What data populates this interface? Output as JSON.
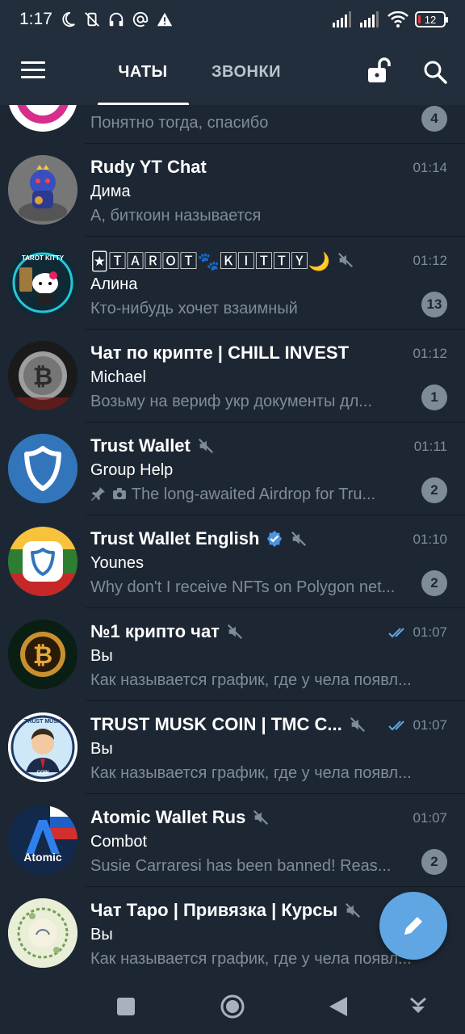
{
  "status_bar": {
    "time": "1:17",
    "battery_level": "12",
    "icons": [
      "moon-icon",
      "vibrate-off-icon",
      "headphones-icon",
      "at-icon",
      "warning-icon",
      "signal-icon",
      "signal-icon",
      "wifi-icon",
      "battery-icon"
    ]
  },
  "header": {
    "tabs": [
      {
        "label": "ЧАТЫ",
        "active": true
      },
      {
        "label": "ЗВОНКИ",
        "active": false
      }
    ],
    "icons": [
      "menu-icon",
      "lock-open-icon",
      "search-icon"
    ]
  },
  "colors": {
    "background": "#1d2733",
    "header": "#232e3c",
    "secondary_text": "#7f8c99",
    "badge": "#7e8b98",
    "accent": "#5fa6e3",
    "verified": "#4a95e0",
    "read_ticks": "#5fa6e3"
  },
  "chats": [
    {
      "title": "",
      "sender": "",
      "preview": "Понятно тогда, спасибо",
      "time": "",
      "badge": "4",
      "muted": false
    },
    {
      "title": "Rudy YT Chat",
      "sender": "Дима",
      "preview": "А, биткоин называется",
      "time": "01:14",
      "badge": "",
      "muted": false
    },
    {
      "title": "🃏🅃🄰🅁🄾🅃🐾🄺🄸🅃🅃🅈🌙",
      "sender": "Алина",
      "preview": "Кто-нибудь хочет взаимный",
      "time": "01:12",
      "badge": "13",
      "muted": true
    },
    {
      "title": "Чат по крипте | CHILL INVEST",
      "sender": "Michael",
      "preview": "Возьму на вериф укр документы дл...",
      "time": "01:12",
      "badge": "1",
      "muted": false
    },
    {
      "title": "Trust Wallet",
      "sender": "Group Help",
      "preview": "The long-awaited Airdrop for Tru...",
      "time": "01:11",
      "badge": "2",
      "muted": true,
      "pinned_photo": true
    },
    {
      "title": "Trust Wallet English",
      "sender": "Younes",
      "preview": "Why don't I receive NFTs on Polygon net...",
      "time": "01:10",
      "badge": "2",
      "muted": true,
      "verified": true
    },
    {
      "title": "№1 крипто чат",
      "sender": "Вы",
      "preview": "Как называется график, где у чела появл...",
      "time": "01:07",
      "badge": "",
      "muted": true,
      "read": true
    },
    {
      "title": "TRUST MUSK COIN | TMC C...",
      "sender": "Вы",
      "preview": "Как называется график, где у чела появл...",
      "time": "01:07",
      "badge": "",
      "muted": true,
      "read": true
    },
    {
      "title": "Atomic Wallet Rus",
      "sender": "Combot",
      "preview": "Susie Carraresi has been banned! Reas...",
      "time": "01:07",
      "badge": "2",
      "muted": true
    },
    {
      "title": "Чат Таро | Привязка | Курсы",
      "sender": "Вы",
      "preview": "Как называется график, где у чела появл...",
      "time": "",
      "badge": "",
      "muted": true
    }
  ],
  "avatar_text": {
    "tarot": "TAROT KITTY",
    "trust_musk": "TRUST MUSK",
    "trust_musk_coin": "COIN",
    "atomic": "Atomic"
  },
  "fab": {
    "icon": "pencil-icon"
  },
  "nav_bar": {
    "icons": [
      "recent-apps-icon",
      "home-icon",
      "back-icon",
      "notifications-icon"
    ]
  }
}
